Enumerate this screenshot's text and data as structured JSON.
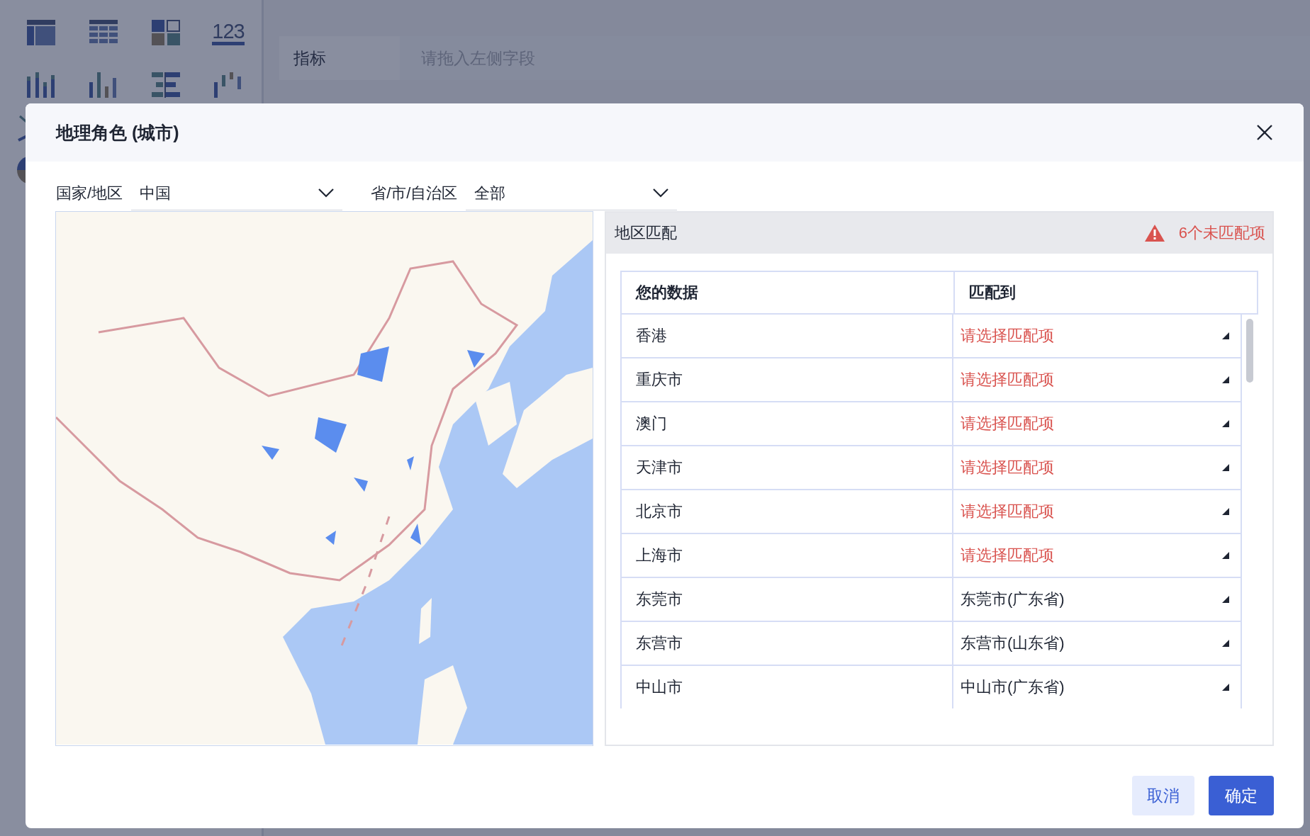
{
  "background": {
    "chart_icons": [
      {
        "kind": "table"
      },
      {
        "kind": "grid"
      },
      {
        "kind": "blocks"
      },
      {
        "kind": "number",
        "label": "123"
      },
      {
        "kind": "stacked-bars"
      },
      {
        "kind": "bars"
      },
      {
        "kind": "hbars"
      },
      {
        "kind": "waterfall"
      }
    ],
    "fields": [
      {
        "label": "指标",
        "placeholder": "请拖入左侧字段"
      }
    ]
  },
  "dialog": {
    "title": "地理角色 (城市)",
    "filters": [
      {
        "label": "国家/地区",
        "value": "中国"
      },
      {
        "label": "省/市/自治区",
        "value": "全部"
      }
    ],
    "panel": {
      "title": "地区匹配",
      "warning": "6个未匹配项",
      "columns": [
        "您的数据",
        "匹配到"
      ],
      "rows": [
        {
          "data": "香港",
          "match": "请选择匹配项",
          "matched": false
        },
        {
          "data": "重庆市",
          "match": "请选择匹配项",
          "matched": false
        },
        {
          "data": "澳门",
          "match": "请选择匹配项",
          "matched": false
        },
        {
          "data": "天津市",
          "match": "请选择匹配项",
          "matched": false
        },
        {
          "data": "北京市",
          "match": "请选择匹配项",
          "matched": false
        },
        {
          "data": "上海市",
          "match": "请选择匹配项",
          "matched": false
        },
        {
          "data": "东莞市",
          "match": "东莞市(广东省)",
          "matched": true
        },
        {
          "data": "东营市",
          "match": "东营市(山东省)",
          "matched": true
        },
        {
          "data": "中山市",
          "match": "中山市(广东省)",
          "matched": true
        }
      ]
    },
    "buttons": [
      {
        "label": "取消",
        "kind": "secondary"
      },
      {
        "label": "确定",
        "kind": "primary"
      }
    ]
  }
}
